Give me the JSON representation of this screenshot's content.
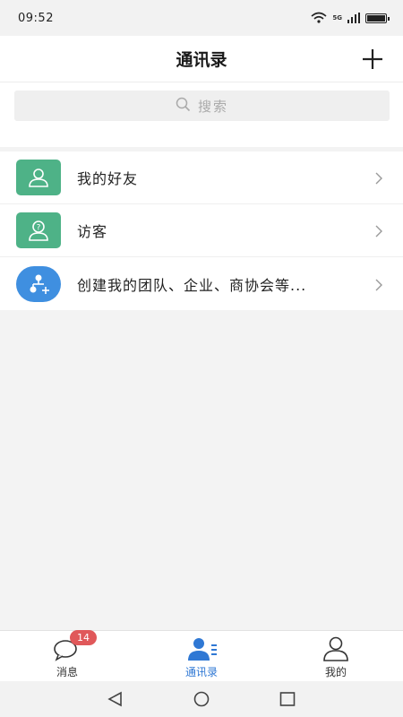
{
  "status_bar": {
    "time": "09:52",
    "network_label": "5G",
    "wifi_label": "6"
  },
  "header": {
    "title": "通讯录",
    "add_icon": "plus-icon"
  },
  "search": {
    "placeholder": "搜索",
    "icon": "search-icon"
  },
  "contacts_menu": {
    "items": [
      {
        "label": "我的好友",
        "icon": "person-icon",
        "color": "#4eb287"
      },
      {
        "label": "访客",
        "icon": "visitor-icon",
        "color": "#4eb287"
      },
      {
        "label": "创建我的团队、企业、商协会等...",
        "icon": "org-add-icon",
        "color": "#3f8fe0"
      }
    ]
  },
  "tab_bar": {
    "accent": "#2f78d4",
    "tabs": [
      {
        "label": "消息",
        "icon": "chat-bubble-icon",
        "badge": "14",
        "active": false
      },
      {
        "label": "通讯录",
        "icon": "contacts-icon",
        "active": true
      },
      {
        "label": "我的",
        "icon": "profile-icon",
        "active": false
      }
    ]
  },
  "system_nav": {
    "buttons": [
      "back-icon",
      "home-icon",
      "recents-icon"
    ]
  }
}
